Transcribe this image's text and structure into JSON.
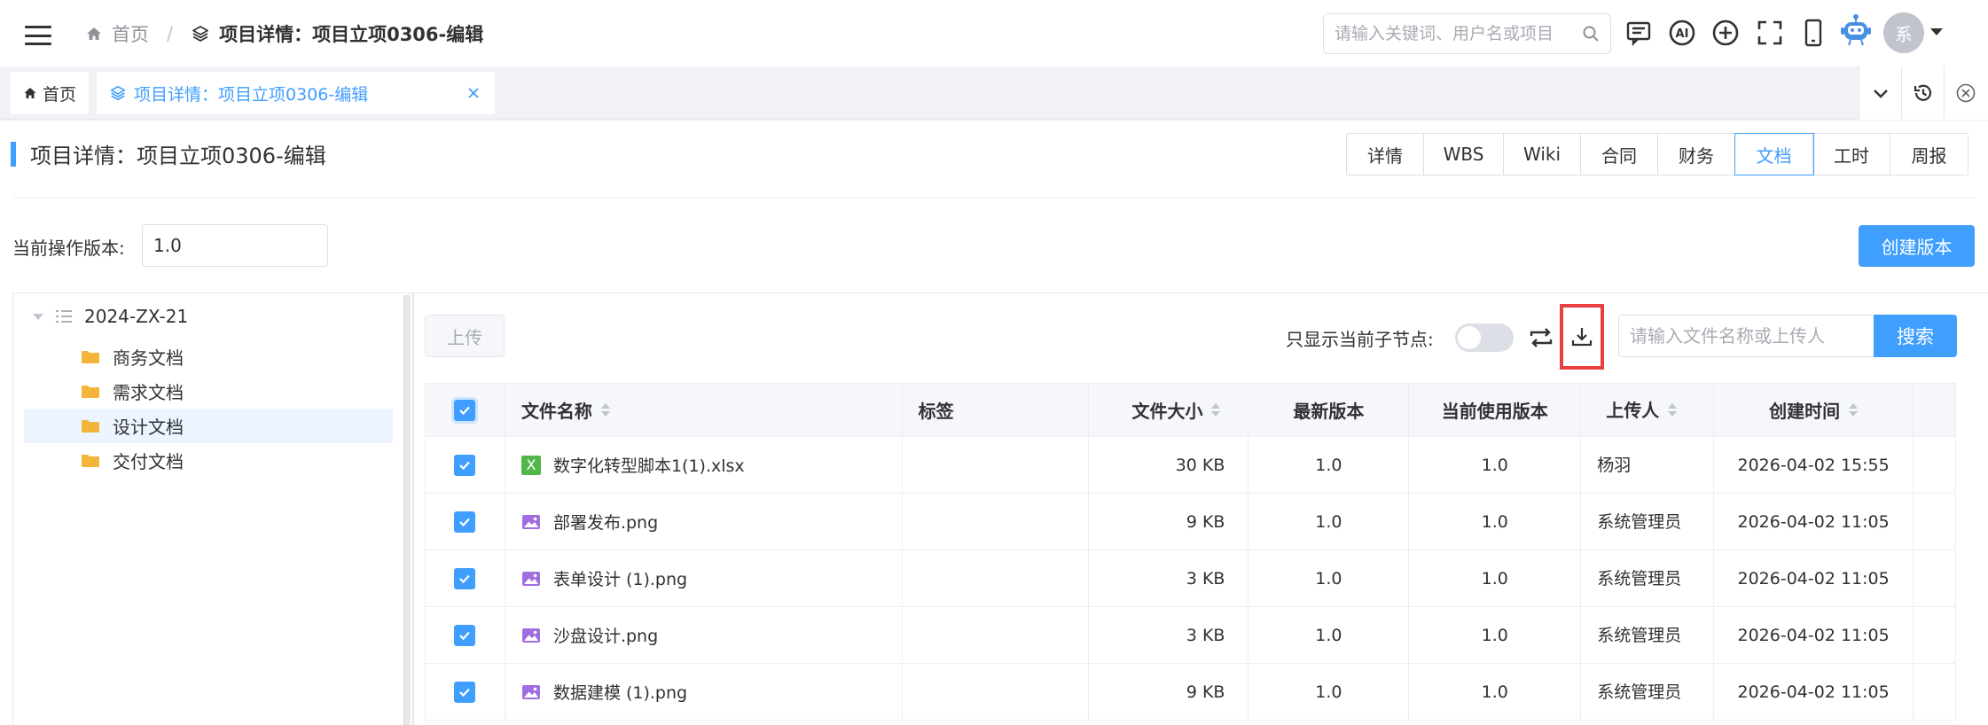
{
  "header": {
    "breadcrumb_home": "首页",
    "breadcrumb_sep": "/",
    "breadcrumb_current": "项目详情：项目立项0306-编辑",
    "search_placeholder": "请输入关键词、用户名或项目",
    "avatar_text": "系"
  },
  "tabs": {
    "home": "首页",
    "current": "项目详情：项目立项0306-编辑"
  },
  "page": {
    "title": "项目详情：项目立项0306-编辑",
    "segments": [
      {
        "label": "详情",
        "width": 62
      },
      {
        "label": "WBS",
        "width": 62
      },
      {
        "label": "Wiki",
        "width": 62
      },
      {
        "label": "合同",
        "width": 62
      },
      {
        "label": "财务",
        "width": 62
      },
      {
        "label": "文档",
        "width": 62,
        "active": true
      },
      {
        "label": "工时",
        "width": 62
      },
      {
        "label": "周报",
        "width": 62
      }
    ],
    "version_label": "当前操作版本:",
    "version_value": "1.0",
    "create_version": "创建版本"
  },
  "tree": {
    "root": "2024-ZX-21",
    "children": [
      "商务文档",
      "需求文档",
      "设计文档",
      "交付文档"
    ],
    "selected_index": 2
  },
  "docs": {
    "upload": "上传",
    "switch_label": "只显示当前子节点:",
    "search_placeholder": "请输入文件名称或上传人",
    "search_btn": "搜索",
    "columns": [
      "文件名称",
      "标签",
      "文件大小",
      "最新版本",
      "当前使用版本",
      "上传人",
      "创建时间"
    ],
    "rows": [
      {
        "type": "xlsx",
        "name": "数字化转型脚本1(1).xlsx",
        "tag": "",
        "size": "30 KB",
        "latest": "1.0",
        "current": "1.0",
        "uploader": "杨羽",
        "created": "2026-04-02 15:55"
      },
      {
        "type": "png",
        "name": "部署发布.png",
        "tag": "",
        "size": "9 KB",
        "latest": "1.0",
        "current": "1.0",
        "uploader": "系统管理员",
        "created": "2026-04-02 11:05"
      },
      {
        "type": "png",
        "name": "表单设计 (1).png",
        "tag": "",
        "size": "3 KB",
        "latest": "1.0",
        "current": "1.0",
        "uploader": "系统管理员",
        "created": "2026-04-02 11:05"
      },
      {
        "type": "png",
        "name": "沙盘设计.png",
        "tag": "",
        "size": "3 KB",
        "latest": "1.0",
        "current": "1.0",
        "uploader": "系统管理员",
        "created": "2026-04-02 11:05"
      },
      {
        "type": "png",
        "name": "数据建模 (1).png",
        "tag": "",
        "size": "9 KB",
        "latest": "1.0",
        "current": "1.0",
        "uploader": "系统管理员",
        "created": "2026-04-02 11:05"
      }
    ]
  },
  "colors": {
    "accent": "#409eff",
    "highlight_box": "#e84040",
    "excel": "#52b748",
    "image_icon": "#a06ee1"
  },
  "icons": [
    "menu-icon",
    "home-icon",
    "layers-icon",
    "search-icon",
    "message-icon",
    "ai-icon",
    "plus-circle-icon",
    "fullscreen-icon",
    "mobile-icon",
    "robot-icon",
    "chevron-down-icon",
    "history-icon",
    "close-circle-icon",
    "swap-icon",
    "download-icon"
  ]
}
